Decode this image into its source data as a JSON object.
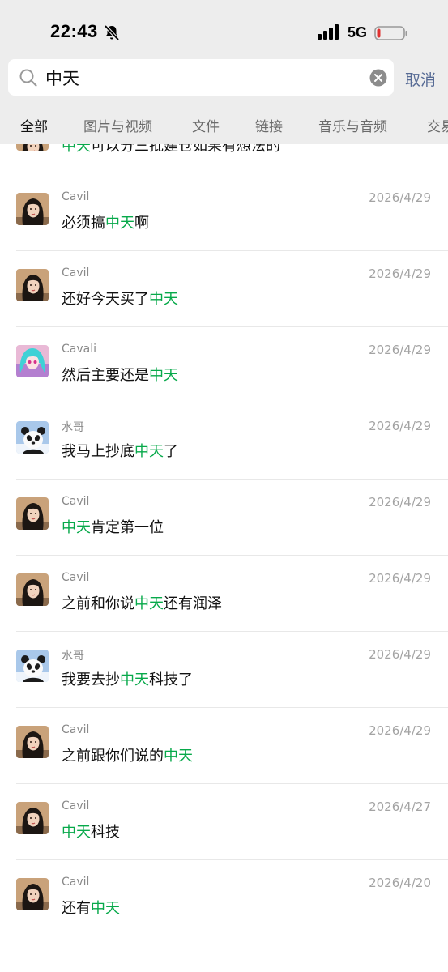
{
  "status": {
    "time": "22:43",
    "network": "5G"
  },
  "search": {
    "query": "中天",
    "cancel_label": "取消"
  },
  "tabs": [
    {
      "label": "全部",
      "active": true
    },
    {
      "label": "图片与视频"
    },
    {
      "label": "文件"
    },
    {
      "label": "链接"
    },
    {
      "label": "音乐与音频"
    },
    {
      "label": "交易"
    }
  ],
  "colors": {
    "highlight": "#07a94a",
    "cancel": "#576b95",
    "header_bg": "#ededed"
  },
  "partial_message": {
    "highlight": "中天",
    "after": "可以分三批建仓如果有想法的"
  },
  "results": [
    {
      "sender": "Cavil",
      "date": "2026/4/29",
      "avatar": "woman-avatar",
      "before": "必须搞",
      "highlight": "中天",
      "after": "啊"
    },
    {
      "sender": "Cavil",
      "date": "2026/4/29",
      "avatar": "woman-avatar",
      "before": "还好今天买了",
      "highlight": "中天",
      "after": ""
    },
    {
      "sender": "Cavali",
      "date": "2026/4/29",
      "avatar": "anime-avatar",
      "before": "然后主要还是",
      "highlight": "中天",
      "after": ""
    },
    {
      "sender": "水哥",
      "date": "2026/4/29",
      "avatar": "panda-avatar",
      "before": "我马上抄底",
      "highlight": "中天",
      "after": "了"
    },
    {
      "sender": "Cavil",
      "date": "2026/4/29",
      "avatar": "woman-avatar",
      "before": "",
      "highlight": "中天",
      "after": "肯定第一位"
    },
    {
      "sender": "Cavil",
      "date": "2026/4/29",
      "avatar": "woman-avatar",
      "before": "之前和你说",
      "highlight": "中天",
      "after": "还有润泽"
    },
    {
      "sender": "水哥",
      "date": "2026/4/29",
      "avatar": "panda-avatar",
      "before": "我要去抄",
      "highlight": "中天",
      "after": "科技了"
    },
    {
      "sender": "Cavil",
      "date": "2026/4/29",
      "avatar": "woman-avatar",
      "before": "之前跟你们说的",
      "highlight": "中天",
      "after": ""
    },
    {
      "sender": "Cavil",
      "date": "2026/4/27",
      "avatar": "woman-avatar",
      "before": "",
      "highlight": "中天",
      "after": "科技"
    },
    {
      "sender": "Cavil",
      "date": "2026/4/20",
      "avatar": "woman-avatar",
      "before": "还有",
      "highlight": "中天",
      "after": ""
    }
  ]
}
